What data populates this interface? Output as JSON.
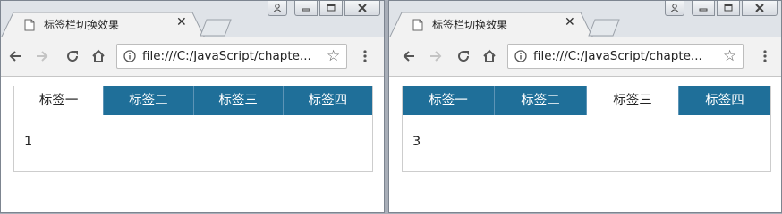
{
  "windows": [
    {
      "tab_title": "标签栏切换效果",
      "url": "file:///C:/JavaScript/chapte...",
      "tabs": [
        "标签一",
        "标签二",
        "标签三",
        "标签四"
      ],
      "active_tab": 0,
      "panel_content": "1"
    },
    {
      "tab_title": "标签栏切换效果",
      "url": "file:///C:/JavaScript/chapte...",
      "tabs": [
        "标签一",
        "标签二",
        "标签三",
        "标签四"
      ],
      "active_tab": 2,
      "panel_content": "3"
    }
  ],
  "colors": {
    "tab_bar": "#1f6f99",
    "tab_active": "#ffffff",
    "tab_text": "#ffffff"
  },
  "icons": [
    "page-icon",
    "close-icon",
    "back-arrow-icon",
    "forward-arrow-icon",
    "reload-icon",
    "home-icon",
    "info-icon",
    "star-icon",
    "menu-icon",
    "user-icon",
    "minimize-icon",
    "maximize-icon"
  ]
}
